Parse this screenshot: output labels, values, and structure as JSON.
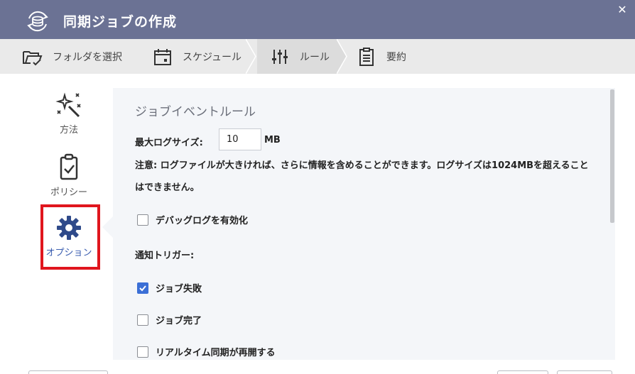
{
  "window": {
    "title": "同期ジョブの作成",
    "close_glyph": "✕",
    "title_icon": "sync-storage-icon"
  },
  "steps": [
    {
      "label": "フォルダを選択",
      "icon": "folder-select-icon"
    },
    {
      "label": "スケジュール",
      "icon": "calendar-icon"
    },
    {
      "label": "ルール",
      "icon": "sliders-icon",
      "active": true
    },
    {
      "label": "要約",
      "icon": "clipboard-list-icon"
    }
  ],
  "sidenav": [
    {
      "label": "方法",
      "icon": "magic-wand-icon"
    },
    {
      "label": "ポリシー",
      "icon": "clipboard-check-icon"
    },
    {
      "label": "オプション",
      "icon": "gear-icon",
      "selected": true
    }
  ],
  "content": {
    "section_title": "ジョブイベントルール",
    "max_log_label": "最大ログサイズ:",
    "max_log_value": "10",
    "max_log_unit": "MB",
    "note": "注意: ログファイルが大きければ、さらに情報を含めることができます。ログサイズは1024MBを超えることはできません。",
    "debug_log_label": "デバッグログを有効化",
    "debug_log_checked": false,
    "notify_trigger_label": "通知トリガー:",
    "triggers": [
      {
        "label": "ジョブ失敗",
        "checked": true
      },
      {
        "label": "ジョブ完了",
        "checked": false
      },
      {
        "label": "リアルタイム同期が再開する",
        "checked": false
      }
    ]
  },
  "colors": {
    "titlebar": "#6b7294",
    "accent": "#3b6fd6",
    "highlight_box": "#e0161e"
  }
}
